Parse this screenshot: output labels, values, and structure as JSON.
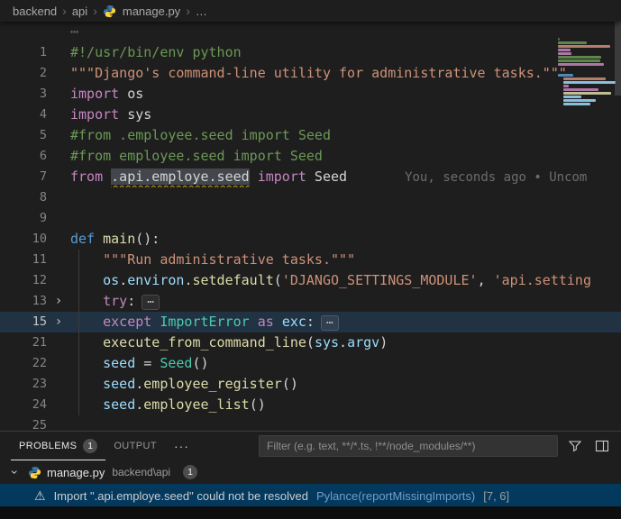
{
  "breadcrumb": {
    "items": [
      "backend",
      "api",
      "manage.py",
      "…"
    ],
    "separator": "›"
  },
  "icons": {
    "chevron": "›",
    "warning": "⚠",
    "dots": "···"
  },
  "editor": {
    "fold_ellipsis": "⋯",
    "rows": [
      {
        "tokens": [
          {
            "t": "⋯",
            "s": "dim"
          }
        ]
      },
      {
        "num": "1",
        "tokens": [
          {
            "t": "#!/usr/bin/env python",
            "s": "com"
          }
        ]
      },
      {
        "num": "2",
        "tokens": [
          {
            "t": "\"\"\"Django's command-line utility for administrative tasks.\"\"\"",
            "s": "str"
          }
        ]
      },
      {
        "num": "3",
        "tokens": [
          {
            "t": "import",
            "s": "kw"
          },
          {
            "t": " os",
            "s": "plain"
          }
        ]
      },
      {
        "num": "4",
        "tokens": [
          {
            "t": "import",
            "s": "kw"
          },
          {
            "t": " sys",
            "s": "plain"
          }
        ]
      },
      {
        "num": "5",
        "chg": true,
        "tokens": [
          {
            "t": "#from .employee.seed import Seed",
            "s": "com"
          }
        ]
      },
      {
        "num": "6",
        "chg": true,
        "tokens": [
          {
            "t": "#from employee.seed import Seed",
            "s": "com"
          }
        ]
      },
      {
        "num": "7",
        "chg": true,
        "blame": "You, seconds ago • Uncom",
        "tokens": [
          {
            "t": "from",
            "s": "kw"
          },
          {
            "t": " ",
            "s": "plain"
          },
          {
            "t": ".api.employe.seed",
            "s": "plain",
            "m": "err"
          },
          {
            "t": " ",
            "s": "plain"
          },
          {
            "t": "import",
            "s": "kw"
          },
          {
            "t": " Seed",
            "s": "plain"
          }
        ]
      },
      {
        "num": "8",
        "tokens": []
      },
      {
        "num": "9",
        "tokens": []
      },
      {
        "num": "10",
        "tokens": [
          {
            "t": "def",
            "s": "def"
          },
          {
            "t": " ",
            "s": "plain"
          },
          {
            "t": "main",
            "s": "fn"
          },
          {
            "t": "():",
            "s": "plain"
          }
        ]
      },
      {
        "num": "11",
        "tokens": [
          {
            "t": "    ",
            "s": "plain"
          },
          {
            "t": "\"\"\"Run administrative tasks.\"\"\"",
            "s": "str"
          }
        ]
      },
      {
        "num": "12",
        "tokens": [
          {
            "t": "    ",
            "s": "plain"
          },
          {
            "t": "os",
            "s": "var"
          },
          {
            "t": ".",
            "s": "plain"
          },
          {
            "t": "environ",
            "s": "var"
          },
          {
            "t": ".",
            "s": "plain"
          },
          {
            "t": "setdefault",
            "s": "fn"
          },
          {
            "t": "(",
            "s": "plain"
          },
          {
            "t": "'DJANGO_SETTINGS_MODULE'",
            "s": "str"
          },
          {
            "t": ", ",
            "s": "plain"
          },
          {
            "t": "'api.setting",
            "s": "str"
          }
        ]
      },
      {
        "num": "13",
        "fold": true,
        "ellipsis": true,
        "tokens": [
          {
            "t": "    ",
            "s": "plain"
          },
          {
            "t": "try",
            "s": "kw"
          },
          {
            "t": ":",
            "s": "plain"
          }
        ]
      },
      {
        "num": "15",
        "fold": true,
        "ellipsis": true,
        "hl": true,
        "tokens": [
          {
            "t": "    ",
            "s": "plain"
          },
          {
            "t": "except",
            "s": "kw"
          },
          {
            "t": " ",
            "s": "plain"
          },
          {
            "t": "ImportError",
            "s": "cls"
          },
          {
            "t": " ",
            "s": "plain"
          },
          {
            "t": "as",
            "s": "kw"
          },
          {
            "t": " ",
            "s": "plain"
          },
          {
            "t": "exc",
            "s": "var"
          },
          {
            "t": ":",
            "s": "plain"
          }
        ]
      },
      {
        "num": "21",
        "tokens": [
          {
            "t": "    ",
            "s": "plain"
          },
          {
            "t": "execute_from_command_line",
            "s": "fn"
          },
          {
            "t": "(",
            "s": "plain"
          },
          {
            "t": "sys",
            "s": "var"
          },
          {
            "t": ".",
            "s": "plain"
          },
          {
            "t": "argv",
            "s": "var"
          },
          {
            "t": ")",
            "s": "plain"
          }
        ]
      },
      {
        "num": "22",
        "tokens": [
          {
            "t": "    ",
            "s": "plain"
          },
          {
            "t": "seed",
            "s": "var"
          },
          {
            "t": " = ",
            "s": "plain"
          },
          {
            "t": "Seed",
            "s": "cls"
          },
          {
            "t": "()",
            "s": "plain"
          }
        ]
      },
      {
        "num": "23",
        "tokens": [
          {
            "t": "    ",
            "s": "plain"
          },
          {
            "t": "seed",
            "s": "var"
          },
          {
            "t": ".",
            "s": "plain"
          },
          {
            "t": "employee_register",
            "s": "fn"
          },
          {
            "t": "()",
            "s": "plain"
          }
        ]
      },
      {
        "num": "24",
        "tokens": [
          {
            "t": "    ",
            "s": "plain"
          },
          {
            "t": "seed",
            "s": "var"
          },
          {
            "t": ".",
            "s": "plain"
          },
          {
            "t": "employee_list",
            "s": "fn"
          },
          {
            "t": "()",
            "s": "plain"
          }
        ]
      },
      {
        "num": "25",
        "tokens": []
      }
    ]
  },
  "panel": {
    "tabs": [
      {
        "label": "PROBLEMS",
        "badge": "1",
        "active": true
      },
      {
        "label": "OUTPUT"
      }
    ],
    "more_label": "···",
    "filter_placeholder": "Filter (e.g. text, **/*.ts, !**/node_modules/**)",
    "tree": {
      "file": "manage.py",
      "path": "backend\\api",
      "badge": "1"
    },
    "problem": {
      "message": "Import \".api.employe.seed\" could not be resolved",
      "source": "Pylance(reportMissingImports)",
      "position": "[7, 6]"
    }
  },
  "colors": {
    "background": "#1e1e1e",
    "selection_row": "#04395e",
    "current_line": "#264f78",
    "warning_squiggle": "#c3a000",
    "git_modified": "#2090d3"
  }
}
